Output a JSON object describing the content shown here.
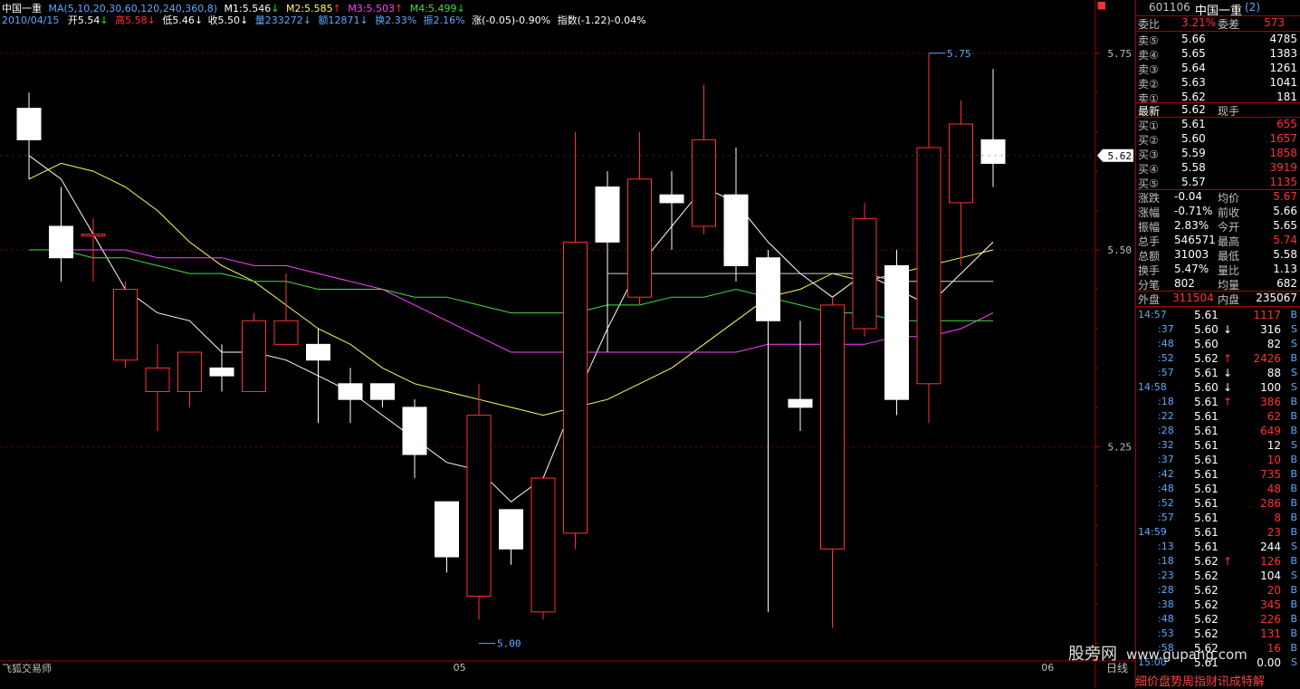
{
  "header": {
    "stock_name": "中国一重",
    "ma_label": "MA(5,10,20,30,60,120,240,360,8)",
    "m1": "M1:5.546",
    "m2": "M2:5.585",
    "m3": "M3:5.503",
    "m4": "M4:5.499",
    "date": "2010/04/15",
    "open": "开5.54",
    "high": "高5.58",
    "low": "低5.46",
    "close": "收5.50",
    "volume": "量233272",
    "amount": "额12871",
    "turnover": "换2.33%",
    "amplitude": "振2.16%",
    "change": "涨(-0.05)-0.90%",
    "index": "指数(-1.22)-0.04%",
    "arrows": {
      "open": "↓",
      "high": "↓",
      "low": "↓",
      "close": "↓",
      "m1": "↓",
      "m2": "↑",
      "m3": "↑",
      "m4": "↓",
      "volume": "↓",
      "amount": "↓",
      "turnover": "↓"
    }
  },
  "colors": {
    "up": "#ff3232",
    "down_fill": "#ffffff",
    "grid": "#7a0000",
    "ma_white": "#ffffff",
    "ma_yellow": "#ffff55",
    "ma_magenta": "#ff44ff",
    "ma_green": "#44dd44",
    "ma_gray": "#d0d0d0"
  },
  "chart_data": {
    "type": "candlestick",
    "y_ticks": [
      "5.75",
      "5.50",
      "5.25"
    ],
    "ylim": [
      4.98,
      5.79
    ],
    "x_labels": [
      "05",
      "06"
    ],
    "period_label": "日线",
    "high_annotation": "5.75",
    "low_annotation": "5.00",
    "current_price_tag": "5.62",
    "candles": [
      {
        "o": 5.68,
        "h": 5.7,
        "l": 5.59,
        "c": 5.64
      },
      {
        "o": 5.53,
        "h": 5.58,
        "l": 5.46,
        "c": 5.49
      },
      {
        "o": 5.52,
        "h": 5.54,
        "l": 5.46,
        "c": 5.52
      },
      {
        "o": 5.36,
        "h": 5.46,
        "l": 5.35,
        "c": 5.45
      },
      {
        "o": 5.32,
        "h": 5.38,
        "l": 5.27,
        "c": 5.35
      },
      {
        "o": 5.32,
        "h": 5.37,
        "l": 5.3,
        "c": 5.37
      },
      {
        "o": 5.35,
        "h": 5.38,
        "l": 5.32,
        "c": 5.34
      },
      {
        "o": 5.32,
        "h": 5.42,
        "l": 5.32,
        "c": 5.41
      },
      {
        "o": 5.38,
        "h": 5.47,
        "l": 5.38,
        "c": 5.41
      },
      {
        "o": 5.38,
        "h": 5.4,
        "l": 5.28,
        "c": 5.36
      },
      {
        "o": 5.33,
        "h": 5.35,
        "l": 5.28,
        "c": 5.31
      },
      {
        "o": 5.33,
        "h": 5.33,
        "l": 5.3,
        "c": 5.31
      },
      {
        "o": 5.3,
        "h": 5.31,
        "l": 5.21,
        "c": 5.24
      },
      {
        "o": 5.18,
        "h": 5.18,
        "l": 5.09,
        "c": 5.11
      },
      {
        "o": 5.06,
        "h": 5.33,
        "l": 5.03,
        "c": 5.29
      },
      {
        "o": 5.17,
        "h": 5.17,
        "l": 5.1,
        "c": 5.12
      },
      {
        "o": 5.04,
        "h": 5.2,
        "l": 5.03,
        "c": 5.21
      },
      {
        "o": 5.14,
        "h": 5.65,
        "l": 5.12,
        "c": 5.51
      },
      {
        "o": 5.58,
        "h": 5.6,
        "l": 5.37,
        "c": 5.51
      },
      {
        "o": 5.44,
        "h": 5.65,
        "l": 5.43,
        "c": 5.59
      },
      {
        "o": 5.57,
        "h": 5.6,
        "l": 5.5,
        "c": 5.56
      },
      {
        "o": 5.53,
        "h": 5.71,
        "l": 5.52,
        "c": 5.64
      },
      {
        "o": 5.57,
        "h": 5.63,
        "l": 5.46,
        "c": 5.48
      },
      {
        "o": 5.49,
        "h": 5.5,
        "l": 5.04,
        "c": 5.41
      },
      {
        "o": 5.31,
        "h": 5.41,
        "l": 5.27,
        "c": 5.3
      },
      {
        "o": 5.12,
        "h": 5.44,
        "l": 5.02,
        "c": 5.43
      },
      {
        "o": 5.4,
        "h": 5.56,
        "l": 5.39,
        "c": 5.54
      },
      {
        "o": 5.48,
        "h": 5.5,
        "l": 5.29,
        "c": 5.31
      },
      {
        "o": 5.33,
        "h": 5.75,
        "l": 5.28,
        "c": 5.63
      },
      {
        "o": 5.56,
        "h": 5.69,
        "l": 5.48,
        "c": 5.66
      },
      {
        "o": 5.64,
        "h": 5.73,
        "l": 5.58,
        "c": 5.61
      }
    ],
    "series": [
      {
        "color": "#ffffff",
        "values": [
          5.62,
          5.59,
          5.52,
          5.45,
          5.42,
          5.41,
          5.37,
          5.37,
          5.36,
          5.34,
          5.32,
          5.29,
          5.26,
          5.23,
          5.22,
          5.18,
          5.21,
          5.31,
          5.4,
          5.48,
          5.53,
          5.58,
          5.56,
          5.51,
          5.47,
          5.44,
          5.47,
          5.45,
          5.43,
          5.47,
          5.51
        ]
      },
      {
        "color": "#ffff55",
        "values": [
          5.59,
          5.61,
          5.6,
          5.58,
          5.55,
          5.51,
          5.48,
          5.46,
          5.43,
          5.4,
          5.38,
          5.35,
          5.33,
          5.32,
          5.31,
          5.3,
          5.29,
          5.3,
          5.31,
          5.33,
          5.35,
          5.38,
          5.41,
          5.44,
          5.45,
          5.47,
          5.46,
          5.47,
          5.48,
          5.49,
          5.5
        ]
      },
      {
        "color": "#d0d0d0",
        "values": [
          null,
          null,
          null,
          null,
          null,
          null,
          null,
          null,
          null,
          null,
          null,
          null,
          null,
          null,
          null,
          null,
          null,
          null,
          5.47,
          5.47,
          5.47,
          5.47,
          5.47,
          5.47,
          5.47,
          5.47,
          5.47,
          5.46,
          5.46,
          5.46,
          5.46
        ]
      },
      {
        "color": "#ff44ff",
        "values": [
          5.5,
          5.5,
          5.5,
          5.5,
          5.49,
          5.49,
          5.49,
          5.48,
          5.48,
          5.47,
          5.46,
          5.45,
          5.43,
          5.41,
          5.39,
          5.37,
          5.37,
          5.37,
          5.37,
          5.37,
          5.37,
          5.37,
          5.37,
          5.38,
          5.38,
          5.38,
          5.38,
          5.39,
          5.39,
          5.4,
          5.42
        ]
      },
      {
        "color": "#44dd44",
        "values": [
          5.5,
          5.5,
          5.49,
          5.49,
          5.48,
          5.47,
          5.47,
          5.46,
          5.46,
          5.45,
          5.45,
          5.45,
          5.44,
          5.44,
          5.43,
          5.42,
          5.42,
          5.42,
          5.43,
          5.43,
          5.44,
          5.44,
          5.45,
          5.44,
          5.43,
          5.42,
          5.42,
          5.41,
          5.41,
          5.41,
          5.41
        ]
      }
    ]
  },
  "panel": {
    "code": "601106",
    "name": "中国一重",
    "name_suffix": "(2)",
    "weibi_label": "委比",
    "weibi_value": "3.21%",
    "weicha_label": "委差",
    "weicha_value": "573",
    "asks": [
      {
        "label": "卖⑤",
        "price": "5.66",
        "vol": "4785"
      },
      {
        "label": "卖④",
        "price": "5.65",
        "vol": "1383"
      },
      {
        "label": "卖③",
        "price": "5.64",
        "vol": "1261"
      },
      {
        "label": "卖②",
        "price": "5.63",
        "vol": "1041"
      },
      {
        "label": "卖①",
        "price": "5.62",
        "vol": "181"
      }
    ],
    "last_label": "最新",
    "last_price": "5.62",
    "last_tag": "现手",
    "bids": [
      {
        "label": "买①",
        "price": "5.61",
        "vol": "655"
      },
      {
        "label": "买②",
        "price": "5.60",
        "vol": "1657"
      },
      {
        "label": "买③",
        "price": "5.59",
        "vol": "1858"
      },
      {
        "label": "买④",
        "price": "5.58",
        "vol": "3919"
      },
      {
        "label": "买⑤",
        "price": "5.57",
        "vol": "1135"
      }
    ],
    "stats": [
      {
        "l1": "涨跌",
        "v1": "-0.04",
        "l2": "均价",
        "v2": "5.67",
        "c2": "#ff3232"
      },
      {
        "l1": "涨幅",
        "v1": "-0.71%",
        "l2": "前收",
        "v2": "5.66",
        "c2": "#ffffff"
      },
      {
        "l1": "振幅",
        "v1": "2.83%",
        "l2": "今开",
        "v2": "5.65",
        "c2": "#ffffff"
      },
      {
        "l1": "总手",
        "v1": "546571",
        "l2": "最高",
        "v2": "5.74",
        "c2": "#ff3232"
      },
      {
        "l1": "总额",
        "v1": "31003",
        "l2": "最低",
        "v2": "5.58",
        "c2": "#ffffff"
      },
      {
        "l1": "换手",
        "v1": "5.47%",
        "l2": "量比",
        "v2": "1.13",
        "c2": "#ffffff"
      },
      {
        "l1": "分笔",
        "v1": "802",
        "l2": "均量",
        "v2": "682",
        "c2": "#ffffff"
      }
    ],
    "outer_label": "外盘",
    "outer_value": "311504",
    "inner_label": "内盘",
    "inner_value": "235067",
    "ticks": [
      {
        "t": "14:57",
        "p": "5.61",
        "a": "",
        "v": "1117",
        "s": "B"
      },
      {
        "t": ":37",
        "p": "5.60",
        "a": "↓",
        "v": "316",
        "s": "S"
      },
      {
        "t": ":48",
        "p": "5.60",
        "a": "",
        "v": "82",
        "s": "S"
      },
      {
        "t": ":52",
        "p": "5.62",
        "a": "↑",
        "v": "2426",
        "s": "B"
      },
      {
        "t": ":57",
        "p": "5.61",
        "a": "↓",
        "v": "88",
        "s": "S"
      },
      {
        "t": "14:58",
        "p": "5.60",
        "a": "↓",
        "v": "100",
        "s": "S"
      },
      {
        "t": ":18",
        "p": "5.61",
        "a": "↑",
        "v": "386",
        "s": "B"
      },
      {
        "t": ":22",
        "p": "5.61",
        "a": "",
        "v": "62",
        "s": "B"
      },
      {
        "t": ":28",
        "p": "5.61",
        "a": "",
        "v": "649",
        "s": "B"
      },
      {
        "t": ":32",
        "p": "5.61",
        "a": "",
        "v": "12",
        "s": "S"
      },
      {
        "t": ":37",
        "p": "5.61",
        "a": "",
        "v": "10",
        "s": "B"
      },
      {
        "t": ":42",
        "p": "5.61",
        "a": "",
        "v": "735",
        "s": "B"
      },
      {
        "t": ":48",
        "p": "5.61",
        "a": "",
        "v": "48",
        "s": "B"
      },
      {
        "t": ":52",
        "p": "5.61",
        "a": "",
        "v": "286",
        "s": "B"
      },
      {
        "t": ":57",
        "p": "5.61",
        "a": "",
        "v": "8",
        "s": "B"
      },
      {
        "t": "14:59",
        "p": "5.61",
        "a": "",
        "v": "23",
        "s": "B"
      },
      {
        "t": ":13",
        "p": "5.61",
        "a": "",
        "v": "244",
        "s": "S"
      },
      {
        "t": ":18",
        "p": "5.62",
        "a": "↑",
        "v": "126",
        "s": "B"
      },
      {
        "t": ":23",
        "p": "5.62",
        "a": "",
        "v": "104",
        "s": "S"
      },
      {
        "t": ":28",
        "p": "5.62",
        "a": "",
        "v": "20",
        "s": "B"
      },
      {
        "t": ":38",
        "p": "5.62",
        "a": "",
        "v": "345",
        "s": "B"
      },
      {
        "t": ":48",
        "p": "5.62",
        "a": "",
        "v": "226",
        "s": "B"
      },
      {
        "t": ":53",
        "p": "5.62",
        "a": "",
        "v": "131",
        "s": "B"
      },
      {
        "t": ":58",
        "p": "5.62",
        "a": "",
        "v": "16",
        "s": "B"
      },
      {
        "t": "15:00",
        "p": "5.61",
        "a": "",
        "v": "0.00",
        "s": "S"
      }
    ],
    "bottom_tabs": "细价盘势周指财讯成特解"
  },
  "watermark": {
    "text": "股旁网",
    "site": "www.gupang.com"
  },
  "app_name": "飞狐交易师",
  "corner_icon": "⯀"
}
